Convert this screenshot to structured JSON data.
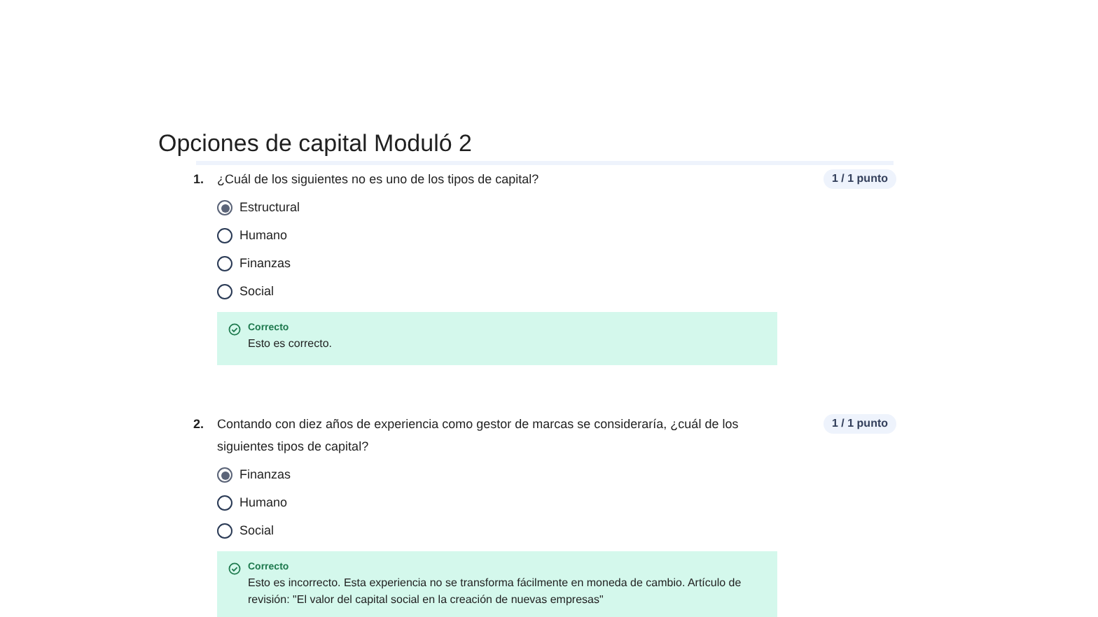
{
  "title": "Opciones de capital Moduló 2",
  "questions": [
    {
      "number": "1.",
      "text": "¿Cuál de los siguientes no es uno de los tipos de capital?",
      "score": "1 / 1 punto",
      "options": [
        {
          "label": "Estructural",
          "selected": true
        },
        {
          "label": "Humano",
          "selected": false
        },
        {
          "label": "Finanzas",
          "selected": false
        },
        {
          "label": "Social",
          "selected": false
        }
      ],
      "feedback": {
        "status": "Correcto",
        "text": "Esto es correcto."
      }
    },
    {
      "number": "2.",
      "text": "Contando con diez años de experiencia como gestor de marcas se consideraría, ¿cuál de los siguientes tipos de capital?",
      "score": "1 / 1 punto",
      "options": [
        {
          "label": "Finanzas",
          "selected": true
        },
        {
          "label": "Humano",
          "selected": false
        },
        {
          "label": "Social",
          "selected": false
        }
      ],
      "feedback": {
        "status": "Correcto",
        "text": "Esto es incorrecto. Esta experiencia no se transforma fácilmente en moneda de cambio. Artículo de revisión: \"El valor del capital social en la creación de nuevas empresas\""
      }
    }
  ]
}
